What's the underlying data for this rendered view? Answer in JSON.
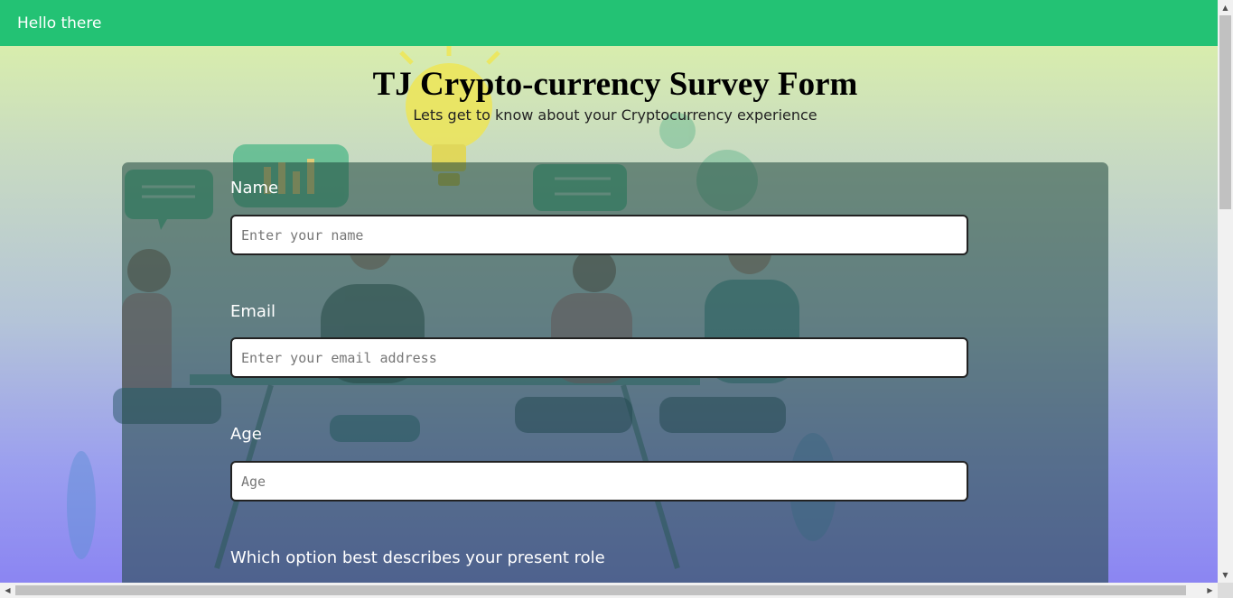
{
  "topbar": {
    "title": "Hello there"
  },
  "header": {
    "title": "TJ Crypto-currency Survey Form",
    "subtitle": "Lets get to know about your Cryptocurrency experience"
  },
  "form": {
    "name": {
      "label": "Name",
      "placeholder": "Enter your name"
    },
    "email": {
      "label": "Email",
      "placeholder": "Enter your email address"
    },
    "age": {
      "label": "Age",
      "placeholder": "Age"
    },
    "role": {
      "label": "Which option best describes your present role"
    }
  },
  "scrollbars": {
    "up": "▲",
    "down": "▼",
    "left": "◀",
    "right": "▶"
  },
  "colors": {
    "topbar": "#23c274",
    "gradient_top": "#dff5a4",
    "gradient_bottom": "#8b85f2"
  }
}
